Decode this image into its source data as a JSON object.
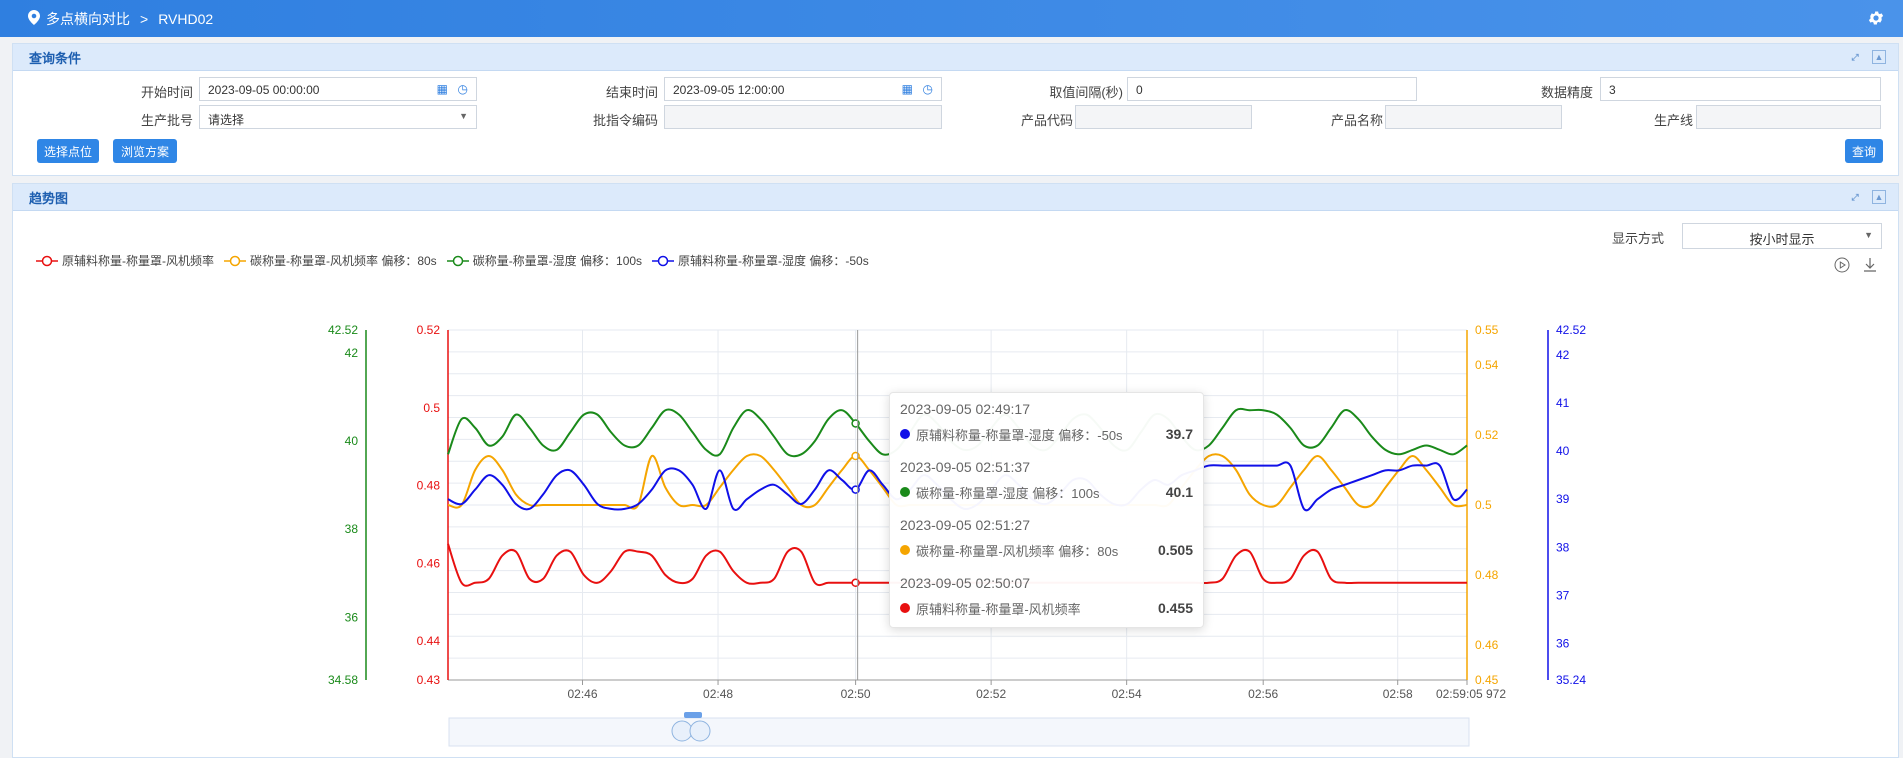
{
  "header": {
    "breadcrumb_1": "多点横向对比",
    "breadcrumb_2": "RVHD02"
  },
  "query": {
    "title": "查询条件",
    "start_label": "开始时间",
    "start_value": "2023-09-05 00:00:00",
    "end_label": "结束时间",
    "end_value": "2023-09-05 12:00:00",
    "interval_label": "取值间隔(秒)",
    "interval_value": "0",
    "precision_label": "数据精度",
    "precision_value": "3",
    "batch_label": "生产批号",
    "batch_placeholder": "请选择",
    "order_label": "批指令编码",
    "product_code_label": "产品代码",
    "product_name_label": "产品名称",
    "line_label": "生产线",
    "select_points_btn": "选择点位",
    "browse_plan_btn": "浏览方案",
    "search_btn": "查询"
  },
  "trend": {
    "title": "趋势图",
    "display_label": "显示方式",
    "display_value": "按小时显示"
  },
  "tooltip": [
    {
      "time": "2023-09-05 02:49:17",
      "name": "原辅料称量-称量罩-湿度 偏移：-50s",
      "value": "39.7",
      "color": "#1010e8"
    },
    {
      "time": "2023-09-05 02:51:37",
      "name": "碳称量-称量罩-湿度 偏移：100s",
      "value": "40.1",
      "color": "#1a8a1a"
    },
    {
      "time": "2023-09-05 02:51:27",
      "name": "碳称量-称量罩-风机频率 偏移：80s",
      "value": "0.505",
      "color": "#f5a500"
    },
    {
      "time": "2023-09-05 02:50:07",
      "name": "原辅料称量-称量罩-风机频率",
      "value": "0.455",
      "color": "#e81010"
    }
  ],
  "chart_data": {
    "type": "line",
    "x_ticks": [
      "02:46",
      "02:48",
      "02:50",
      "02:52",
      "02:54",
      "02:56",
      "02:58",
      "02:59:05 972"
    ],
    "series": [
      {
        "name": "原辅料称量-称量罩-风机频率",
        "color": "#e81010",
        "axis": "red",
        "values": [
          0.465,
          0.455,
          0.455,
          0.456,
          0.462,
          0.463,
          0.456,
          0.456,
          0.462,
          0.463,
          0.457,
          0.455,
          0.458,
          0.463,
          0.463,
          0.462,
          0.457,
          0.455,
          0.456,
          0.462,
          0.463,
          0.458,
          0.455,
          0.455,
          0.456,
          0.463,
          0.463,
          0.455,
          0.455,
          0.455,
          0.455,
          0.455,
          0.455,
          0.455,
          0.455,
          0.455,
          0.455,
          0.455,
          0.455,
          0.455,
          0.455,
          0.455,
          0.455,
          0.455,
          0.455,
          0.455,
          0.455,
          0.455,
          0.455,
          0.455,
          0.455,
          0.455,
          0.455,
          0.455,
          0.455,
          0.455,
          0.455,
          0.456,
          0.462,
          0.463,
          0.456,
          0.455,
          0.456,
          0.462,
          0.463,
          0.456,
          0.455,
          0.455,
          0.455,
          0.455,
          0.455,
          0.455,
          0.455,
          0.455,
          0.455,
          0.455
        ]
      },
      {
        "name": "碳称量-称量罩-风机频率 偏移：80s",
        "color": "#f5a500",
        "axis": "orange",
        "values": [
          0.5,
          0.5,
          0.51,
          0.514,
          0.51,
          0.503,
          0.5,
          0.5,
          0.5,
          0.5,
          0.5,
          0.5,
          0.5,
          0.5,
          0.5,
          0.514,
          0.505,
          0.5,
          0.5,
          0.5,
          0.505,
          0.51,
          0.514,
          0.514,
          0.51,
          0.505,
          0.5,
          0.5,
          0.505,
          0.51,
          0.514,
          0.51,
          0.505,
          0.5,
          0.5,
          0.5,
          0.5,
          0.5,
          0.5,
          0.5,
          0.5,
          0.5,
          0.5,
          0.5,
          0.5,
          0.5,
          0.5,
          0.5,
          0.5,
          0.5,
          0.5,
          0.5,
          0.5,
          0.5,
          0.505,
          0.51,
          0.514,
          0.514,
          0.51,
          0.503,
          0.5,
          0.5,
          0.505,
          0.51,
          0.514,
          0.51,
          0.505,
          0.5,
          0.5,
          0.505,
          0.51,
          0.514,
          0.51,
          0.505,
          0.5,
          0.5
        ]
      },
      {
        "name": "碳称量-称量罩-湿度 偏移：100s",
        "color": "#1a8a1a",
        "axis": "green",
        "values": [
          39.7,
          40.5,
          40.3,
          39.9,
          40.1,
          40.6,
          40.3,
          39.9,
          39.8,
          40.2,
          40.6,
          40.6,
          40.2,
          39.9,
          39.9,
          40.3,
          40.7,
          40.6,
          40.2,
          39.8,
          39.7,
          40.3,
          40.7,
          40.5,
          40.1,
          39.7,
          39.7,
          40.0,
          40.5,
          40.7,
          40.4,
          40.0,
          39.7,
          39.8,
          40.2,
          40.6,
          40.4,
          40.0,
          39.8,
          39.9,
          40.3,
          40.6,
          40.3,
          39.9,
          39.8,
          40.1,
          40.5,
          40.6,
          40.3,
          39.9,
          39.8,
          40.2,
          40.6,
          40.5,
          40.1,
          39.8,
          39.9,
          40.3,
          40.7,
          40.7,
          40.7,
          40.6,
          40.3,
          39.9,
          39.9,
          40.3,
          40.7,
          40.5,
          40.1,
          39.8,
          39.7,
          39.8,
          39.9,
          39.8,
          39.7,
          39.9
        ]
      },
      {
        "name": "原辅料称量-称量罩-湿度 偏移：-50s",
        "color": "#1010e8",
        "axis": "blue",
        "values": [
          39.0,
          38.9,
          39.2,
          39.5,
          39.3,
          38.9,
          38.8,
          39.1,
          39.5,
          39.6,
          39.3,
          38.9,
          38.8,
          38.8,
          38.9,
          39.2,
          39.6,
          39.6,
          39.3,
          38.8,
          39.6,
          38.8,
          39.0,
          39.2,
          39.3,
          39.1,
          38.9,
          39.2,
          39.6,
          39.4,
          39.2,
          39.6,
          39.3,
          39.0,
          39.2,
          39.5,
          39.3,
          39.0,
          38.8,
          38.9,
          39.2,
          39.5,
          39.3,
          39.0,
          38.9,
          39.1,
          39.4,
          39.4,
          39.1,
          38.9,
          38.9,
          39.2,
          39.4,
          39.3,
          39.5,
          39.6,
          39.7,
          39.7,
          39.7,
          39.7,
          39.7,
          39.7,
          39.7,
          38.8,
          39.0,
          39.2,
          39.3,
          39.4,
          39.5,
          39.6,
          39.6,
          39.7,
          39.7,
          39.7,
          39.0,
          39.2
        ]
      }
    ],
    "axes": {
      "green": {
        "min": 34.58,
        "max": 42.52,
        "ticks": [
          "42.52",
          "42",
          "40",
          "38",
          "36",
          "34.58"
        ],
        "color": "#1a8a1a"
      },
      "red": {
        "min": 0.43,
        "max": 0.52,
        "ticks": [
          "0.52",
          "0.5",
          "0.48",
          "0.46",
          "0.44",
          "0.43"
        ],
        "color": "#e81010"
      },
      "orange": {
        "min": 0.45,
        "max": 0.55,
        "ticks": [
          "0.55",
          "0.54",
          "0.52",
          "0.5",
          "0.48",
          "0.46",
          "0.45"
        ],
        "color": "#f5a500"
      },
      "blue": {
        "min": 35.24,
        "max": 42.52,
        "ticks": [
          "42.52",
          "42",
          "41",
          "40",
          "39",
          "38",
          "37",
          "36",
          "35.24"
        ],
        "color": "#1010e8"
      }
    },
    "grid": true
  }
}
